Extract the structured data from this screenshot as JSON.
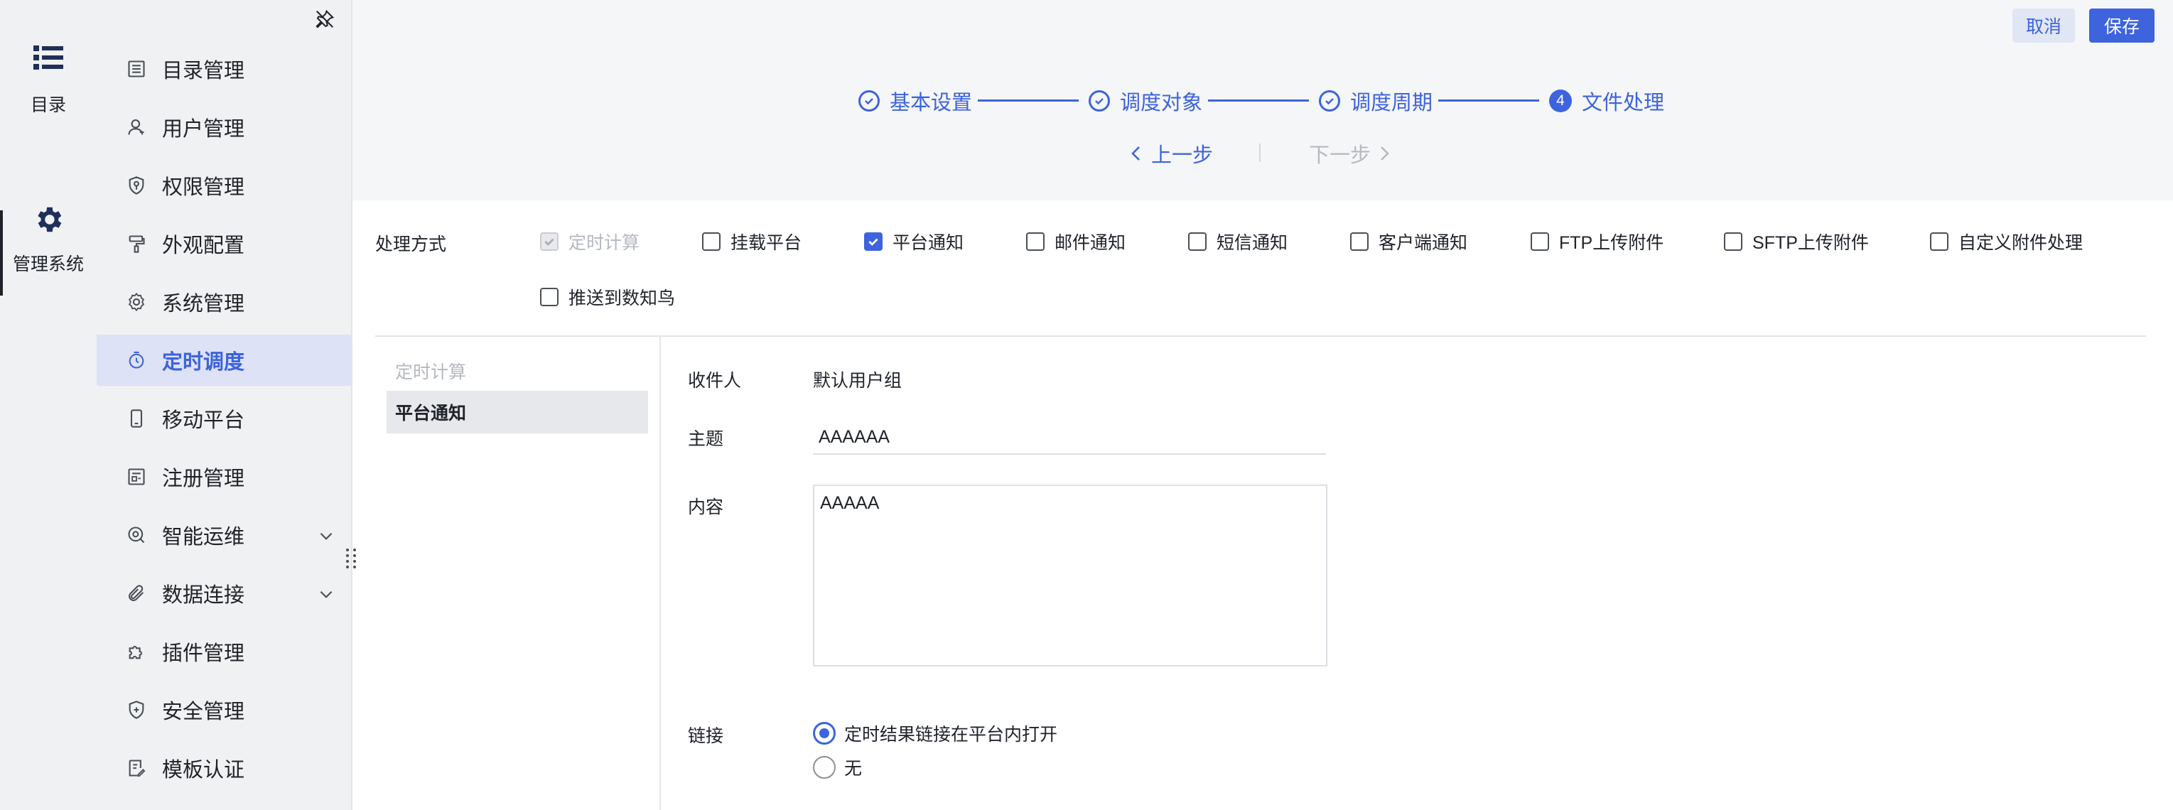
{
  "rail": {
    "catalog_label": "目录",
    "admin_label": "管理系统"
  },
  "nav": {
    "items": [
      {
        "label": "目录管理",
        "icon": "list-doc-icon"
      },
      {
        "label": "用户管理",
        "icon": "user-icon"
      },
      {
        "label": "权限管理",
        "icon": "shield-key-icon"
      },
      {
        "label": "外观配置",
        "icon": "paint-roller-icon"
      },
      {
        "label": "系统管理",
        "icon": "gear-icon"
      },
      {
        "label": "定时调度",
        "icon": "timer-icon",
        "active": true
      },
      {
        "label": "移动平台",
        "icon": "mobile-icon"
      },
      {
        "label": "注册管理",
        "icon": "register-icon"
      },
      {
        "label": "智能运维",
        "icon": "ops-icon",
        "expandable": true
      },
      {
        "label": "数据连接",
        "icon": "paperclip-icon",
        "expandable": true
      },
      {
        "label": "插件管理",
        "icon": "puzzle-icon"
      },
      {
        "label": "安全管理",
        "icon": "security-shield-icon"
      },
      {
        "label": "模板认证",
        "icon": "template-cert-icon"
      }
    ]
  },
  "header": {
    "cancel_label": "取消",
    "save_label": "保存",
    "steps": [
      {
        "label": "基本设置",
        "state": "done"
      },
      {
        "label": "调度对象",
        "state": "done"
      },
      {
        "label": "调度周期",
        "state": "done"
      },
      {
        "label": "文件处理",
        "state": "current",
        "number": "4"
      }
    ],
    "prev_label": "上一步",
    "next_label": "下一步"
  },
  "processing": {
    "label": "处理方式",
    "options": [
      {
        "label": "定时计算",
        "checked": true,
        "disabled": true
      },
      {
        "label": "挂载平台",
        "checked": false
      },
      {
        "label": "平台通知",
        "checked": true
      },
      {
        "label": "邮件通知",
        "checked": false
      },
      {
        "label": "短信通知",
        "checked": false
      },
      {
        "label": "客户端通知",
        "checked": false
      },
      {
        "label": "FTP上传附件",
        "checked": false
      },
      {
        "label": "SFTP上传附件",
        "checked": false
      },
      {
        "label": "自定义附件处理",
        "checked": false
      },
      {
        "label": "推送到数知鸟",
        "checked": false
      }
    ]
  },
  "detail": {
    "side_items": [
      {
        "label": "定时计算",
        "disabled": true
      },
      {
        "label": "平台通知",
        "selected": true
      }
    ],
    "recipient_label": "收件人",
    "recipient_value": "默认用户组",
    "subject_label": "主题",
    "subject_value": "AAAAAA",
    "content_label": "内容",
    "content_value": "AAAAA",
    "link_label": "链接",
    "link_options": [
      {
        "label": "定时结果链接在平台内打开",
        "selected": true
      },
      {
        "label": "无",
        "selected": false
      }
    ]
  },
  "colors": {
    "accent": "#3d63dd",
    "nav_active_bg": "#dde2f7",
    "sidebar_bg": "#f0f1f3",
    "header_bg": "#f5f6f8"
  }
}
